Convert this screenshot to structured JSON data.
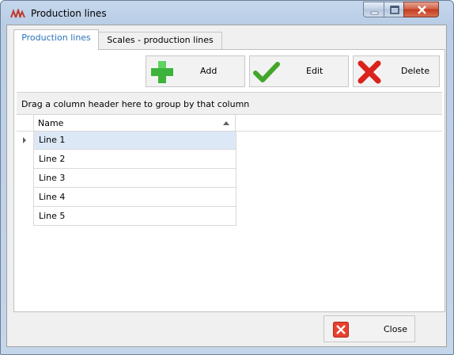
{
  "window": {
    "title": "Production lines"
  },
  "tabs": [
    {
      "label": "Production lines",
      "active": true
    },
    {
      "label": "Scales - production lines",
      "active": false
    }
  ],
  "toolbar": {
    "add_label": "Add",
    "edit_label": "Edit",
    "delete_label": "Delete"
  },
  "grid": {
    "group_hint": "Drag a column header here to group by that column",
    "column_header": "Name",
    "rows": [
      "Line 1",
      "Line 2",
      "Line 3",
      "Line 4",
      "Line 5"
    ]
  },
  "footer": {
    "close_label": "Close"
  },
  "colors": {
    "accent": "#2b73b9",
    "selected_row": "#dde8f6",
    "add_green": "#3cb43c",
    "delete_red": "#d9231c"
  },
  "icons": {
    "add": "plus-icon",
    "edit": "checkmark-icon",
    "delete": "x-icon",
    "close": "close-box-icon"
  }
}
